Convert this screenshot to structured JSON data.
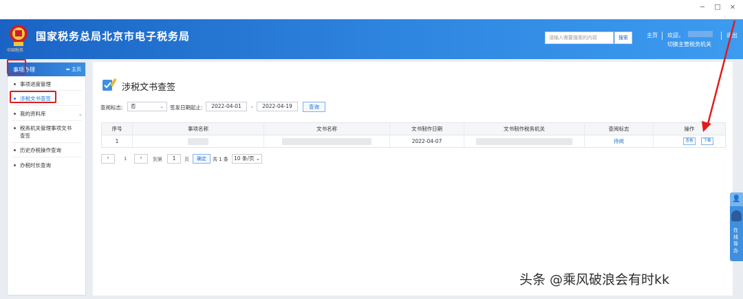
{
  "window": {
    "minimize": "−",
    "maximize": "□",
    "close": "×"
  },
  "header": {
    "site_title": "国家税务总局北京市电子税务局",
    "logo_sub": "中国税务",
    "search_placeholder": "请输入需要搜索的内容",
    "search_button": "搜索",
    "home": "主页",
    "welcome": "欢迎，",
    "switch_org": "切换主管税务机关",
    "logout": "退出"
  },
  "sidebar": {
    "head_label": "事项办理",
    "home_label": "主页",
    "items": [
      {
        "label": "事项进度管理"
      },
      {
        "label": "涉税文书查签"
      },
      {
        "label": "我的资料库"
      },
      {
        "label": "税务机关管理事项文书查签"
      },
      {
        "label": "历史办税操作查询"
      },
      {
        "label": "办税时长查询"
      }
    ]
  },
  "content": {
    "title": "涉税文书查签",
    "filter": {
      "query_flag_label": "查阅标志:",
      "query_flag_value": "否",
      "date_label": "签发日期起止:",
      "date_start": "2022-04-01",
      "date_sep": "-",
      "date_end": "2022-04-19",
      "query_button": "查询"
    },
    "table": {
      "headers": [
        "序号",
        "事项名称",
        "文书名称",
        "文书制作日期",
        "文书制作税务机关",
        "查阅标志",
        "操作"
      ],
      "rows": [
        {
          "index": "1",
          "date": "2022-04-07",
          "status": "待阅",
          "view": "查看",
          "download": "下载"
        }
      ]
    },
    "pager": {
      "prev": "‹",
      "current": "1",
      "next": "›",
      "goto_label": "到第",
      "page_input": "1",
      "page_unit": "页",
      "ok": "确定",
      "total": "共 1 条",
      "page_size": "10 条/页"
    }
  },
  "float_panel": {
    "text": "在线导办"
  },
  "watermark": "头条 @乘风破浪会有时kk",
  "colors": {
    "brand": "#1a63c4",
    "accent": "#1e73d8",
    "highlight": "#e21b1b"
  }
}
